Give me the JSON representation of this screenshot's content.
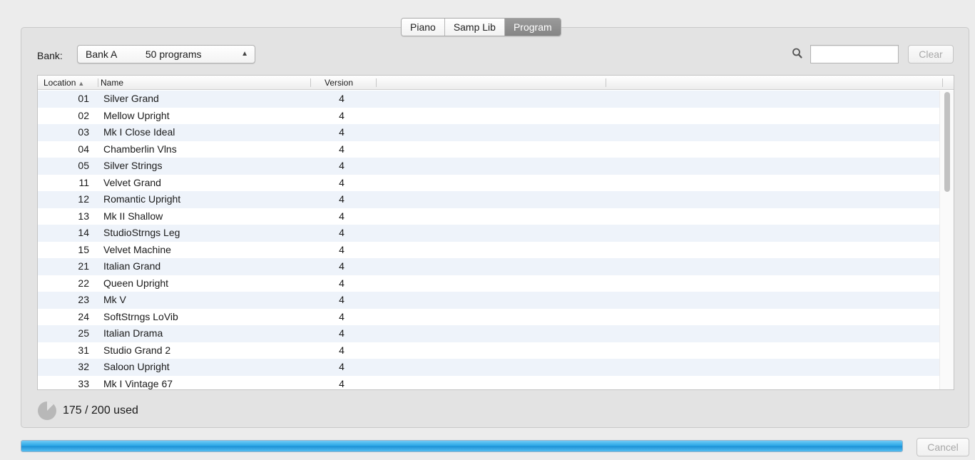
{
  "tabs": [
    {
      "label": "Piano",
      "active": false
    },
    {
      "label": "Samp Lib",
      "active": false
    },
    {
      "label": "Program",
      "active": true
    }
  ],
  "bank": {
    "label": "Bank:",
    "selected_bank": "Bank A",
    "selected_count": "50 programs"
  },
  "search": {
    "value": "",
    "clear_label": "Clear",
    "icon": "search-icon"
  },
  "table": {
    "columns": [
      "Location",
      "Name",
      "Version"
    ],
    "sort_column": "Location",
    "sort_direction": "ascending",
    "rows": [
      {
        "location": "01",
        "name": "Silver Grand",
        "version": "4"
      },
      {
        "location": "02",
        "name": "Mellow Upright",
        "version": "4"
      },
      {
        "location": "03",
        "name": "Mk I Close Ideal",
        "version": "4"
      },
      {
        "location": "04",
        "name": "Chamberlin Vlns",
        "version": "4"
      },
      {
        "location": "05",
        "name": "Silver Strings",
        "version": "4"
      },
      {
        "location": "11",
        "name": "Velvet Grand",
        "version": "4"
      },
      {
        "location": "12",
        "name": "Romantic Upright",
        "version": "4"
      },
      {
        "location": "13",
        "name": "Mk II Shallow",
        "version": "4"
      },
      {
        "location": "14",
        "name": "StudioStrngs Leg",
        "version": "4"
      },
      {
        "location": "15",
        "name": "Velvet Machine",
        "version": "4"
      },
      {
        "location": "21",
        "name": "Italian Grand",
        "version": "4"
      },
      {
        "location": "22",
        "name": "Queen Upright",
        "version": "4"
      },
      {
        "location": "23",
        "name": "Mk V",
        "version": "4"
      },
      {
        "location": "24",
        "name": "SoftStrngs LoVib",
        "version": "4"
      },
      {
        "location": "25",
        "name": "Italian Drama",
        "version": "4"
      },
      {
        "location": "31",
        "name": "Studio Grand 2",
        "version": "4"
      },
      {
        "location": "32",
        "name": "Saloon Upright",
        "version": "4"
      },
      {
        "location": "33",
        "name": "Mk I Vintage 67",
        "version": "4"
      }
    ]
  },
  "usage": {
    "text": "175 / 200 used",
    "fraction": 0.875
  },
  "progress": {
    "fraction": 1.0
  },
  "cancel_label": "Cancel",
  "colors": {
    "active_tab": "#8e8e8e",
    "row_alt": "#eef3fa",
    "progress_fill": "#27a5e5",
    "disabled_text": "#a8a8a8"
  }
}
